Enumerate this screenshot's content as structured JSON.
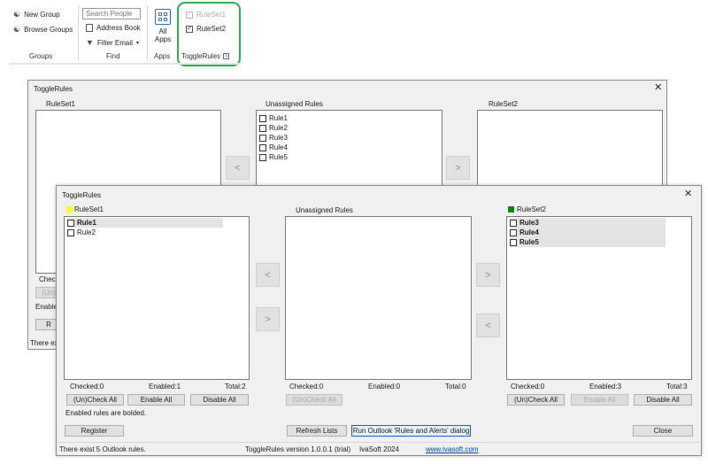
{
  "ribbon": {
    "groups_group": {
      "label": "Groups",
      "new_group": "New Group",
      "browse_groups": "Browse Groups"
    },
    "find_group": {
      "label": "Find",
      "search_placeholder": "Search People",
      "address_book": "Address Book",
      "filter_email": "Filter Email"
    },
    "apps_group": {
      "label": "Apps",
      "all_apps_line1": "All",
      "all_apps_line2": "Apps"
    },
    "togglerules_group": {
      "label": "ToggleRules",
      "ruleset1": "RuleSet1",
      "ruleset2": "RuleSet2"
    }
  },
  "back_dialog": {
    "title": "ToggleRules",
    "ruleset1_label": "RuleSet1",
    "unassigned_label": "Unassigned Rules",
    "ruleset2_label": "RuleSet2",
    "unassigned_items": [
      "Rule1",
      "Rule2",
      "Rule3",
      "Rule4",
      "Rule5"
    ],
    "partial_checked": "Checke",
    "partial_uncheck_btn": "(Un)",
    "partial_enabled": "Enable",
    "partial_register_btn": "R",
    "partial_status": "There exis"
  },
  "front_dialog": {
    "title": "ToggleRules",
    "ruleset1": {
      "label": "RuleSet1",
      "color": "#ffff00",
      "items": [
        {
          "name": "Rule1",
          "bold": true
        },
        {
          "name": "Rule2",
          "bold": false
        }
      ],
      "checked": "Checked:0",
      "enabled": "Enabled:1",
      "total": "Total:2",
      "uncheck_btn": "(Un)Check All",
      "enable_btn": "Enable All",
      "disable_btn": "Disable All"
    },
    "unassigned": {
      "label": "Unassigned Rules",
      "checked": "Checked:0",
      "enabled": "Enabled:0",
      "total": "Total:0",
      "uncheck_btn": "(Un)Check All"
    },
    "ruleset2": {
      "label": "RuleSet2",
      "color": "#0a8a0a",
      "items": [
        {
          "name": "Rule3",
          "bold": true
        },
        {
          "name": "Rule4",
          "bold": true
        },
        {
          "name": "Rule5",
          "bold": true
        }
      ],
      "checked": "Checked:0",
      "enabled": "Enabled:3",
      "total": "Total:3",
      "uncheck_btn": "(Un)Check All",
      "enable_btn": "Enable All",
      "disable_btn": "Disable All"
    },
    "arrows": {
      "left": "<",
      "right": ">"
    },
    "note": "Enabled rules are bolded.",
    "buttons": {
      "register": "Register",
      "refresh": "Refresh Lists",
      "run_dialog": "Run Outlook 'Rules and Alerts' dialog",
      "close": "Close"
    },
    "status": {
      "rules_count": "There exist 5 Outlook rules.",
      "version": "ToggleRules version 1.0.0.1 (trial)",
      "company": "IvaSoft 2024",
      "website": "www.ivasoft.com"
    }
  }
}
